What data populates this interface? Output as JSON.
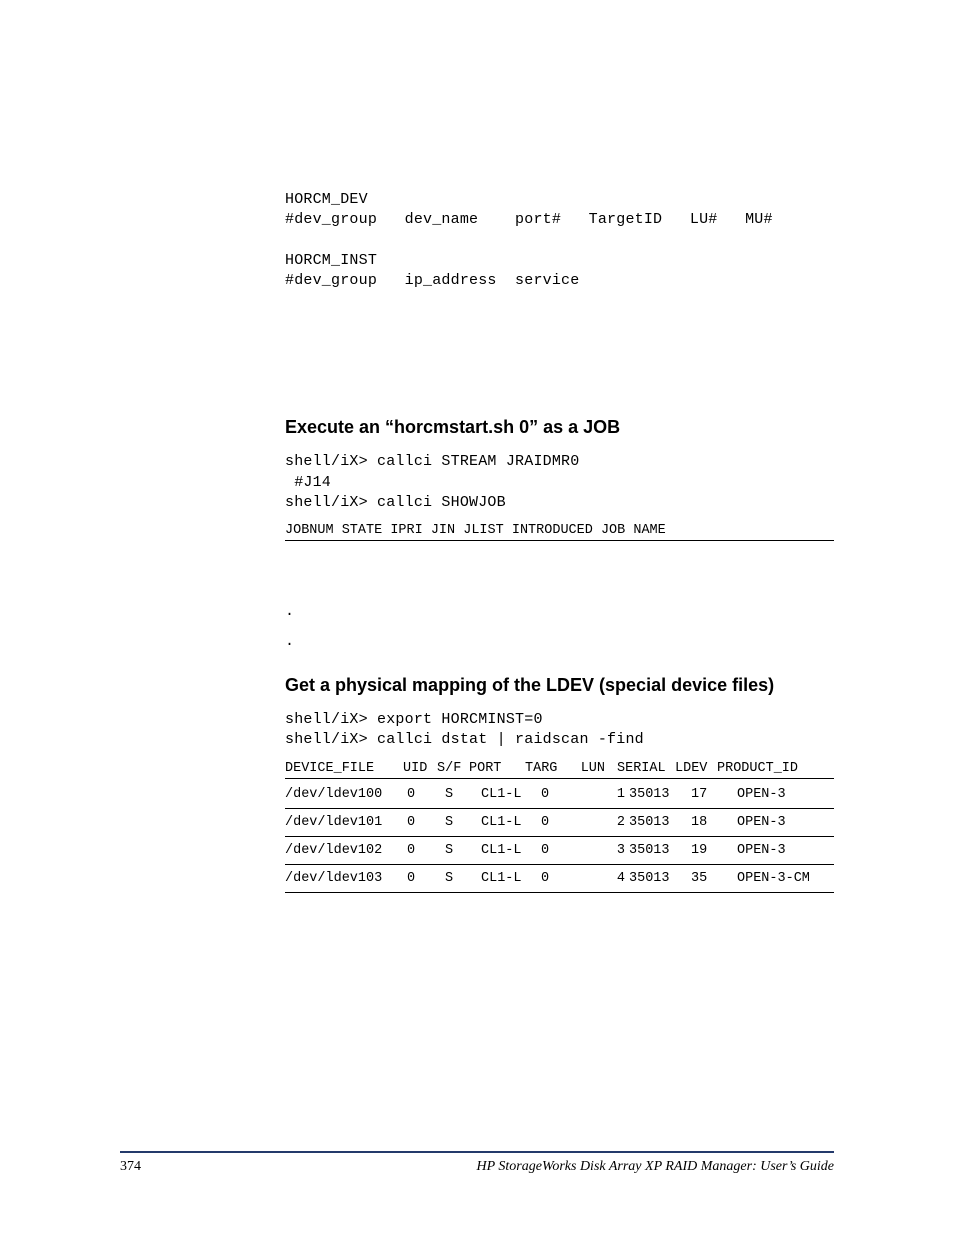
{
  "block1": "HORCM_DEV\n#dev_group   dev_name    port#   TargetID   LU#   MU#\n\nHORCM_INST\n#dev_group   ip_address  service",
  "heading1": "Execute an “horcmstart.sh 0” as a JOB",
  "block2": "shell/iX> callci STREAM JRAIDMR0\n #J14\nshell/iX> callci SHOWJOB",
  "jobhead": "JOBNUM   STATE  IPRI JIN JLIST INTRODUCED JOB NAME",
  "dots": ".\n.",
  "heading2": "Get a physical mapping of the LDEV (special device files)",
  "block3": "shell/iX> export HORCMINST=0\nshell/iX> callci dstat | raidscan -find",
  "tablehead": {
    "device_file": "DEVICE_FILE",
    "uid": "UID",
    "sf": "S/F",
    "port": "PORT",
    "targ": "TARG",
    "lun": "LUN",
    "serial": "SERIAL",
    "ldev": "LDEV",
    "product_id": "PRODUCT_ID"
  },
  "rows": [
    {
      "device_file": "/dev/ldev100",
      "uid": "0",
      "sf": "S",
      "port": "CL1-L",
      "targ": "0",
      "lun": "1",
      "serial": "35013",
      "ldev": "17",
      "product_id": "OPEN-3"
    },
    {
      "device_file": "/dev/ldev101",
      "uid": "0",
      "sf": "S",
      "port": "CL1-L",
      "targ": "0",
      "lun": "2",
      "serial": "35013",
      "ldev": "18",
      "product_id": "OPEN-3"
    },
    {
      "device_file": "/dev/ldev102",
      "uid": "0",
      "sf": "S",
      "port": "CL1-L",
      "targ": "0",
      "lun": "3",
      "serial": "35013",
      "ldev": "19",
      "product_id": "OPEN-3"
    },
    {
      "device_file": "/dev/ldev103",
      "uid": "0",
      "sf": "S",
      "port": "CL1-L",
      "targ": "0",
      "lun": "4",
      "serial": "35013",
      "ldev": "35",
      "product_id": "OPEN-3-CM"
    }
  ],
  "page_number": "374",
  "book_title": "HP StorageWorks Disk Array XP RAID Manager: User’s Guide"
}
